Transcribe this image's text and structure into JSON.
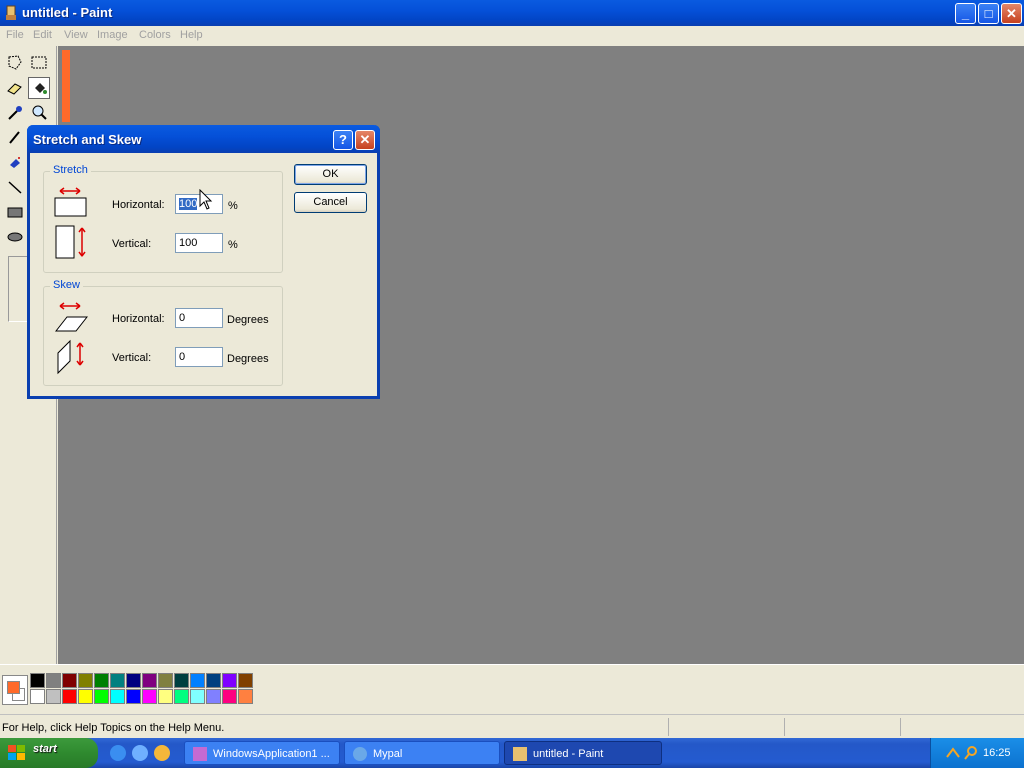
{
  "window": {
    "title": "untitled - Paint",
    "controls": {
      "minimize": "_",
      "maximize": "□",
      "close": "✕"
    }
  },
  "menu": [
    "File",
    "Edit",
    "View",
    "Image",
    "Colors",
    "Help"
  ],
  "dialog": {
    "title": "Stretch and Skew",
    "help_label": "?",
    "close_label": "✕",
    "stretch": {
      "legend": "Stretch",
      "horizontal_label": "Horizontal:",
      "horizontal_value": "100",
      "horizontal_unit": "%",
      "vertical_label": "Vertical:",
      "vertical_value": "100",
      "vertical_unit": "%"
    },
    "skew": {
      "legend": "Skew",
      "horizontal_label": "Horizontal:",
      "horizontal_value": "0",
      "horizontal_unit": "Degrees",
      "vertical_label": "Vertical:",
      "vertical_value": "0",
      "vertical_unit": "Degrees"
    },
    "ok_label": "OK",
    "cancel_label": "Cancel"
  },
  "palette": {
    "foreground": "#ff6a2a",
    "background": "#ffffff",
    "row1": [
      "#000000",
      "#808080",
      "#800000",
      "#808000",
      "#008000",
      "#008080",
      "#000080",
      "#800080",
      "#808040",
      "#004040",
      "#0080ff",
      "#004080",
      "#8000ff",
      "#804000"
    ],
    "row2": [
      "#ffffff",
      "#c0c0c0",
      "#ff0000",
      "#ffff00",
      "#00ff00",
      "#00ffff",
      "#0000ff",
      "#ff00ff",
      "#ffff80",
      "#00ff80",
      "#80ffff",
      "#8080ff",
      "#ff0080",
      "#ff8040"
    ]
  },
  "status": {
    "text": "For Help, click Help Topics on the Help Menu."
  },
  "taskbar": {
    "start_label": "start",
    "tasks": [
      {
        "label": "WindowsApplication1 ...",
        "icon": "visual-studio-icon",
        "active": false
      },
      {
        "label": "Mypal",
        "icon": "browser-icon",
        "active": false
      },
      {
        "label": "untitled - Paint",
        "icon": "paint-icon",
        "active": true
      }
    ],
    "clock": "16:25"
  }
}
